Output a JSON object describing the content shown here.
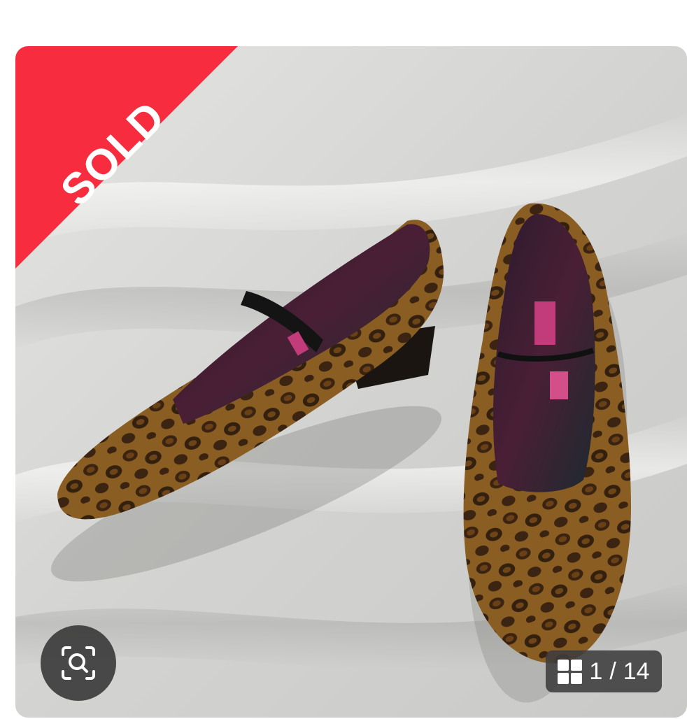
{
  "listing": {
    "status_badge": "SOLD",
    "image_counter": {
      "current": "1",
      "separator": "/",
      "total": "14"
    }
  },
  "icons": {
    "zoom": "zoom-search-icon",
    "gallery": "grid-icon"
  },
  "colors": {
    "sold_banner": "#f72d3f",
    "overlay_button": "#3c3c3c",
    "background": "#ffffff"
  }
}
